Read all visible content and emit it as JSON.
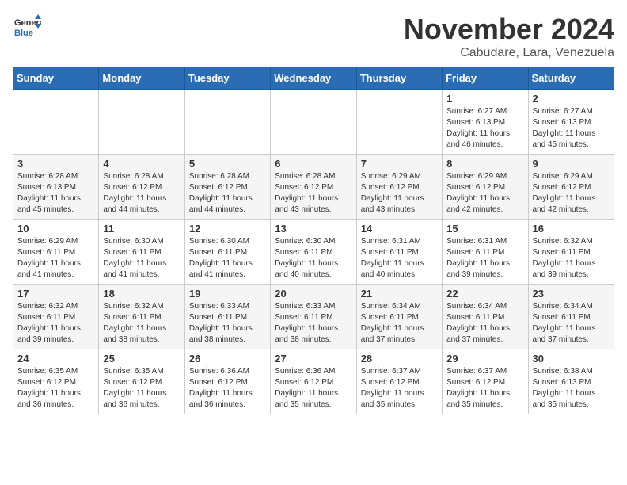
{
  "logo": {
    "general": "General",
    "blue": "Blue"
  },
  "header": {
    "month": "November 2024",
    "location": "Cabudare, Lara, Venezuela"
  },
  "weekdays": [
    "Sunday",
    "Monday",
    "Tuesday",
    "Wednesday",
    "Thursday",
    "Friday",
    "Saturday"
  ],
  "weeks": [
    [
      {
        "day": "",
        "info": ""
      },
      {
        "day": "",
        "info": ""
      },
      {
        "day": "",
        "info": ""
      },
      {
        "day": "",
        "info": ""
      },
      {
        "day": "",
        "info": ""
      },
      {
        "day": "1",
        "info": "Sunrise: 6:27 AM\nSunset: 6:13 PM\nDaylight: 11 hours and 46 minutes."
      },
      {
        "day": "2",
        "info": "Sunrise: 6:27 AM\nSunset: 6:13 PM\nDaylight: 11 hours and 45 minutes."
      }
    ],
    [
      {
        "day": "3",
        "info": "Sunrise: 6:28 AM\nSunset: 6:13 PM\nDaylight: 11 hours and 45 minutes."
      },
      {
        "day": "4",
        "info": "Sunrise: 6:28 AM\nSunset: 6:12 PM\nDaylight: 11 hours and 44 minutes."
      },
      {
        "day": "5",
        "info": "Sunrise: 6:28 AM\nSunset: 6:12 PM\nDaylight: 11 hours and 44 minutes."
      },
      {
        "day": "6",
        "info": "Sunrise: 6:28 AM\nSunset: 6:12 PM\nDaylight: 11 hours and 43 minutes."
      },
      {
        "day": "7",
        "info": "Sunrise: 6:29 AM\nSunset: 6:12 PM\nDaylight: 11 hours and 43 minutes."
      },
      {
        "day": "8",
        "info": "Sunrise: 6:29 AM\nSunset: 6:12 PM\nDaylight: 11 hours and 42 minutes."
      },
      {
        "day": "9",
        "info": "Sunrise: 6:29 AM\nSunset: 6:12 PM\nDaylight: 11 hours and 42 minutes."
      }
    ],
    [
      {
        "day": "10",
        "info": "Sunrise: 6:29 AM\nSunset: 6:11 PM\nDaylight: 11 hours and 41 minutes."
      },
      {
        "day": "11",
        "info": "Sunrise: 6:30 AM\nSunset: 6:11 PM\nDaylight: 11 hours and 41 minutes."
      },
      {
        "day": "12",
        "info": "Sunrise: 6:30 AM\nSunset: 6:11 PM\nDaylight: 11 hours and 41 minutes."
      },
      {
        "day": "13",
        "info": "Sunrise: 6:30 AM\nSunset: 6:11 PM\nDaylight: 11 hours and 40 minutes."
      },
      {
        "day": "14",
        "info": "Sunrise: 6:31 AM\nSunset: 6:11 PM\nDaylight: 11 hours and 40 minutes."
      },
      {
        "day": "15",
        "info": "Sunrise: 6:31 AM\nSunset: 6:11 PM\nDaylight: 11 hours and 39 minutes."
      },
      {
        "day": "16",
        "info": "Sunrise: 6:32 AM\nSunset: 6:11 PM\nDaylight: 11 hours and 39 minutes."
      }
    ],
    [
      {
        "day": "17",
        "info": "Sunrise: 6:32 AM\nSunset: 6:11 PM\nDaylight: 11 hours and 39 minutes."
      },
      {
        "day": "18",
        "info": "Sunrise: 6:32 AM\nSunset: 6:11 PM\nDaylight: 11 hours and 38 minutes."
      },
      {
        "day": "19",
        "info": "Sunrise: 6:33 AM\nSunset: 6:11 PM\nDaylight: 11 hours and 38 minutes."
      },
      {
        "day": "20",
        "info": "Sunrise: 6:33 AM\nSunset: 6:11 PM\nDaylight: 11 hours and 38 minutes."
      },
      {
        "day": "21",
        "info": "Sunrise: 6:34 AM\nSunset: 6:11 PM\nDaylight: 11 hours and 37 minutes."
      },
      {
        "day": "22",
        "info": "Sunrise: 6:34 AM\nSunset: 6:11 PM\nDaylight: 11 hours and 37 minutes."
      },
      {
        "day": "23",
        "info": "Sunrise: 6:34 AM\nSunset: 6:11 PM\nDaylight: 11 hours and 37 minutes."
      }
    ],
    [
      {
        "day": "24",
        "info": "Sunrise: 6:35 AM\nSunset: 6:12 PM\nDaylight: 11 hours and 36 minutes."
      },
      {
        "day": "25",
        "info": "Sunrise: 6:35 AM\nSunset: 6:12 PM\nDaylight: 11 hours and 36 minutes."
      },
      {
        "day": "26",
        "info": "Sunrise: 6:36 AM\nSunset: 6:12 PM\nDaylight: 11 hours and 36 minutes."
      },
      {
        "day": "27",
        "info": "Sunrise: 6:36 AM\nSunset: 6:12 PM\nDaylight: 11 hours and 35 minutes."
      },
      {
        "day": "28",
        "info": "Sunrise: 6:37 AM\nSunset: 6:12 PM\nDaylight: 11 hours and 35 minutes."
      },
      {
        "day": "29",
        "info": "Sunrise: 6:37 AM\nSunset: 6:12 PM\nDaylight: 11 hours and 35 minutes."
      },
      {
        "day": "30",
        "info": "Sunrise: 6:38 AM\nSunset: 6:13 PM\nDaylight: 11 hours and 35 minutes."
      }
    ]
  ]
}
